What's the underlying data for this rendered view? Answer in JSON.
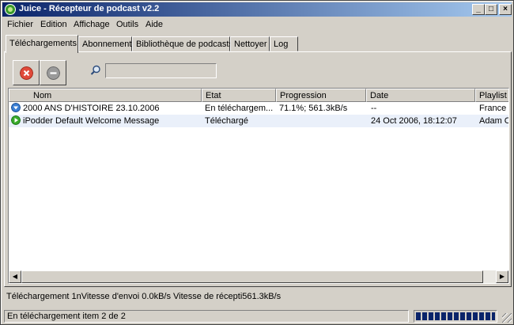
{
  "window": {
    "title": "Juice - Récepteur de podcast v2.2",
    "controls": {
      "minimize": "_",
      "maximize": "□",
      "close": "×"
    }
  },
  "menu": [
    "Fichier",
    "Edition",
    "Affichage",
    "Outils",
    "Aide"
  ],
  "tabs": [
    "Téléchargements",
    "Abonnement",
    "Bibliothèque de podcasts",
    "Nettoyer",
    "Log"
  ],
  "toolbar": {
    "cancel_icon": "x-circle-icon",
    "remove_icon": "minus-circle-icon",
    "search_icon": "magnifier-icon",
    "search_value": ""
  },
  "table": {
    "columns": [
      "Nom",
      "Etat",
      "Progression",
      "Date",
      "Playlist"
    ],
    "rows": [
      {
        "icon": "download-arrow-icon",
        "name": "2000 ANS D'HISTOIRE 23.10.2006",
        "state": "En téléchargem...",
        "progress": "71.1%; 561.3kB/s",
        "date": "--",
        "playlist": "France In"
      },
      {
        "icon": "play-icon",
        "name": "iPodder Default Welcome Message",
        "state": "Téléchargé",
        "progress": "",
        "date": "24 Oct 2006, 18:12:07",
        "playlist": "Adam Cu"
      }
    ]
  },
  "scrollbar": {
    "left_arrow": "◀",
    "right_arrow": "▶"
  },
  "status_line": "Téléchargement 1nVitesse d'envoi 0.0kB/s  Vitesse de récepti561.3kB/s",
  "statusbar": {
    "text": "En téléchargement item 2 de 2",
    "progress": 1.0
  },
  "colors": {
    "titlebar_start": "#0a246a",
    "titlebar_end": "#a6caf0",
    "cancel": "#e04a3a",
    "remove": "#8a8a8a",
    "download_icon": "#3a7fd4",
    "play_icon": "#3aaa2a"
  }
}
